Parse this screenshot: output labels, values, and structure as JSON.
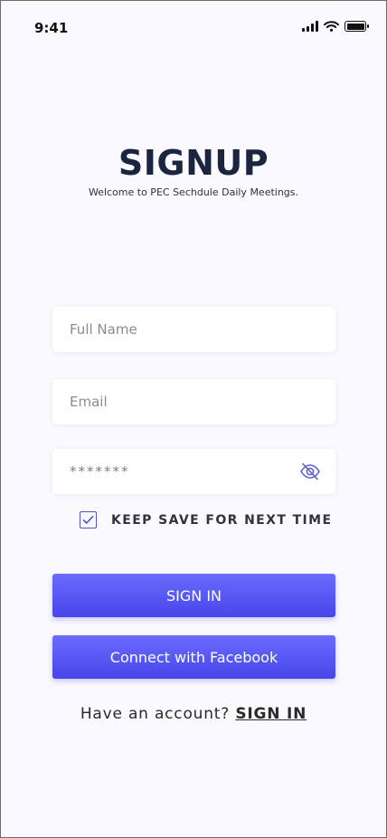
{
  "status_bar": {
    "time": "9:41",
    "icons": [
      "signal-icon",
      "wifi-icon",
      "battery-icon"
    ]
  },
  "header": {
    "title": "SIGNUP",
    "subtitle": "Welcome to PEC Sechdule Daily Meetings."
  },
  "form": {
    "full_name": {
      "placeholder": "Full Name",
      "value": ""
    },
    "email": {
      "placeholder": "Email",
      "value": ""
    },
    "password": {
      "placeholder": "*******",
      "value": "",
      "toggle_icon": "eye-slash-icon"
    },
    "keep_save": {
      "label": "KEEP SAVE FOR NEXT TIME",
      "checked": true
    }
  },
  "buttons": {
    "sign_in": "SIGN IN",
    "facebook": "Connect with Facebook"
  },
  "footer": {
    "prompt": "Have an account?",
    "link": "SIGN IN"
  },
  "colors": {
    "accent": "#5252f2",
    "title": "#1b2540",
    "background": "#f9f9fe"
  }
}
